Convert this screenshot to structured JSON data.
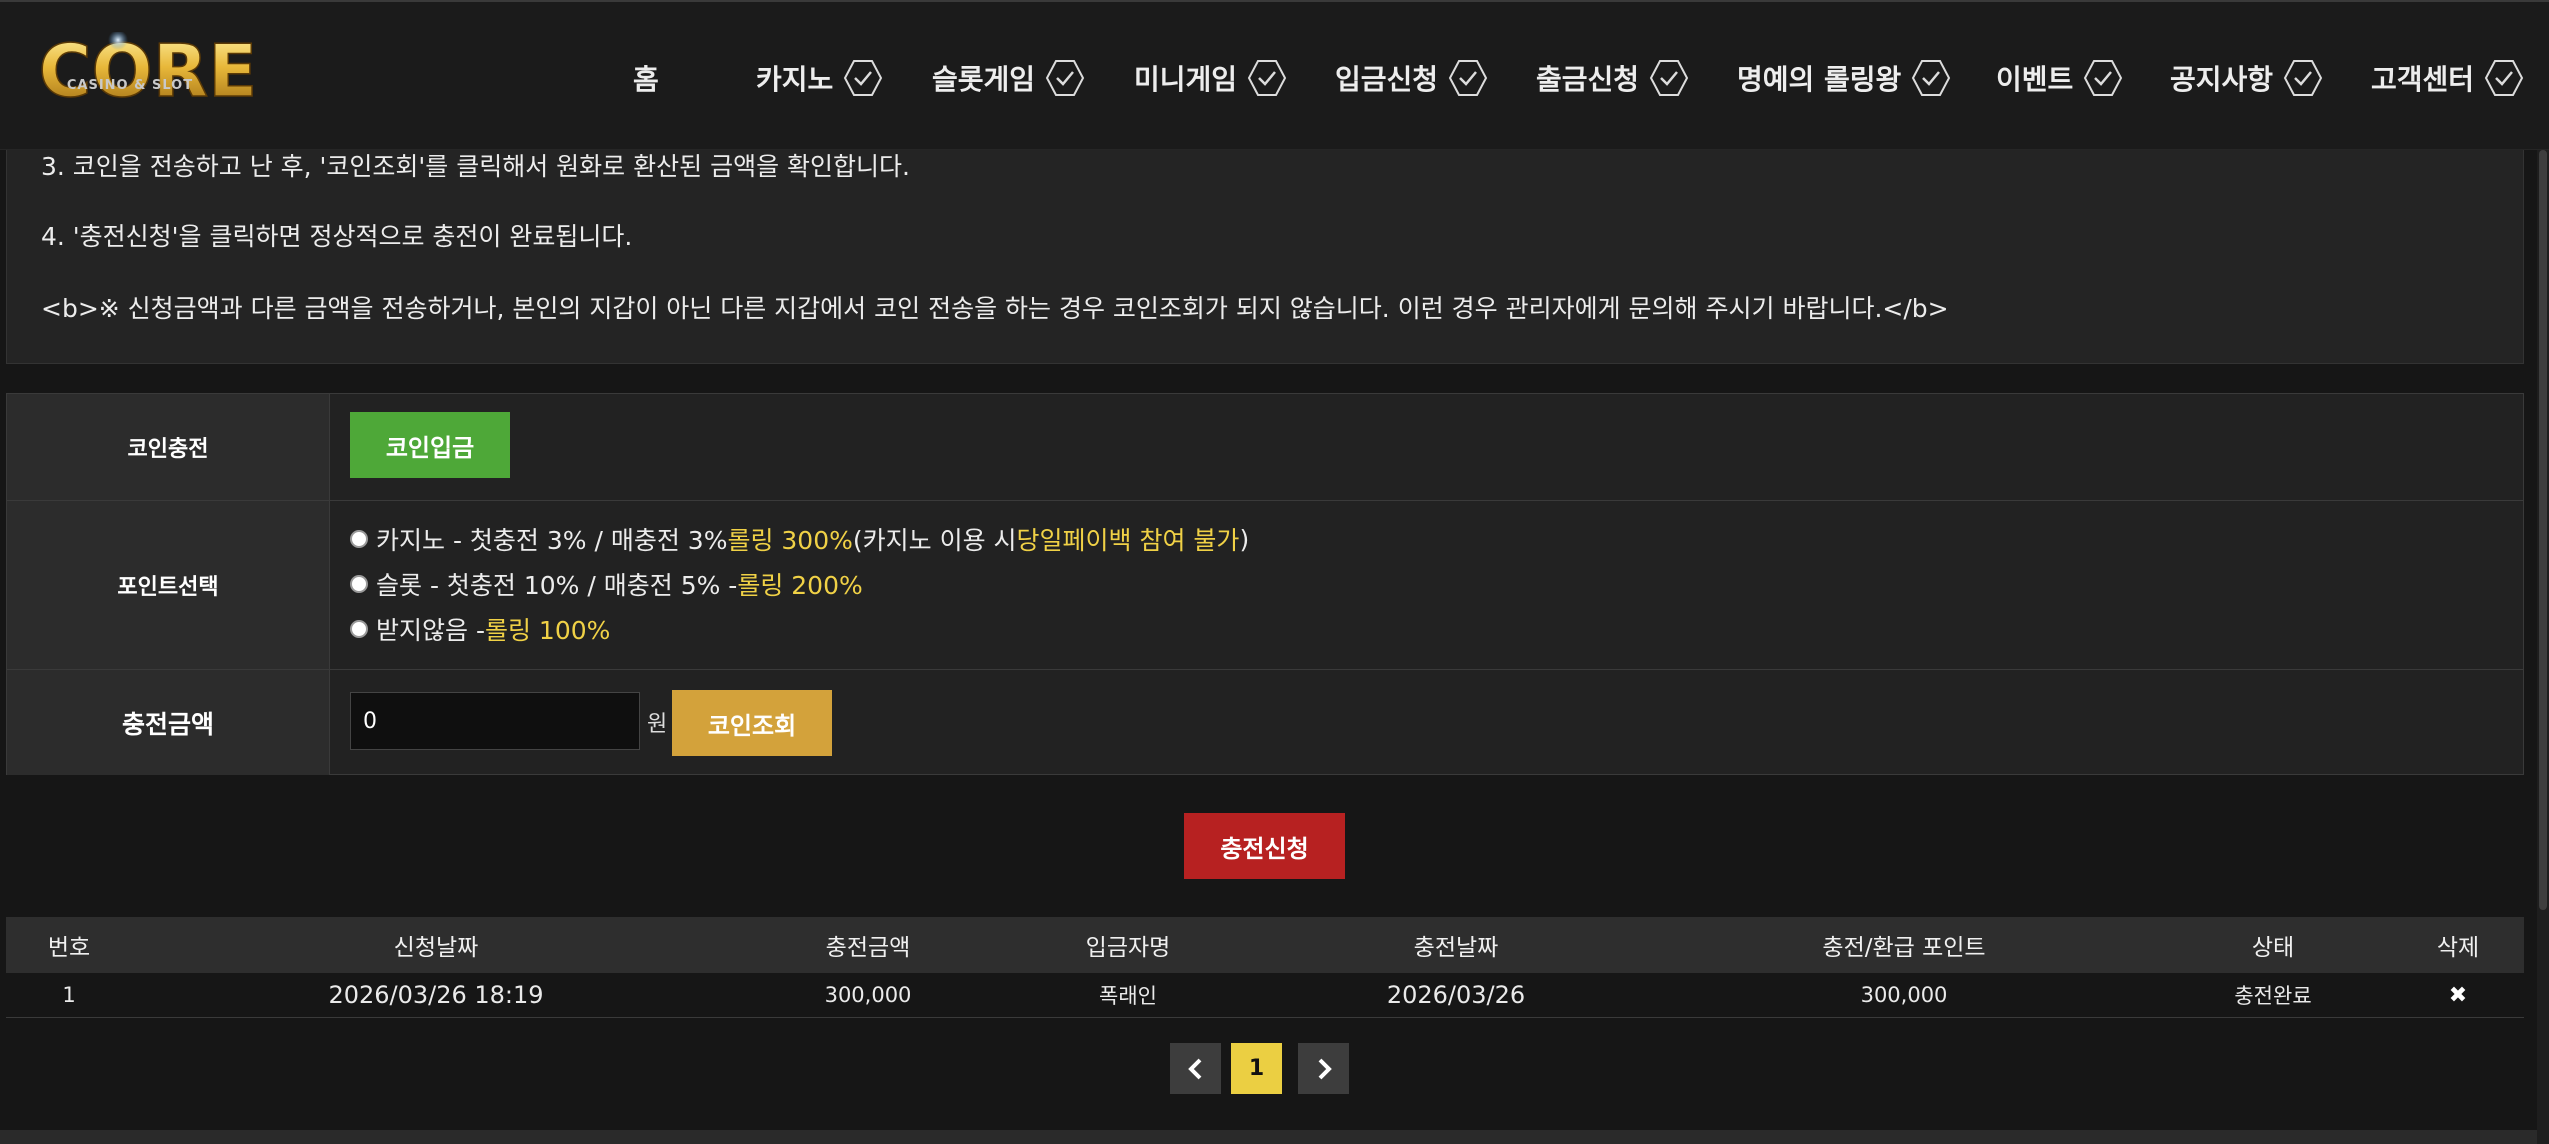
{
  "brand": {
    "logo_text": "CORE",
    "logo_subtitle": "CASINO & SLOT"
  },
  "nav": {
    "items": [
      {
        "label": "홈",
        "has_check": false
      },
      {
        "label": "카지노",
        "has_check": true
      },
      {
        "label": "슬롯게임",
        "has_check": true
      },
      {
        "label": "미니게임",
        "has_check": true
      },
      {
        "label": "입금신청",
        "has_check": true
      },
      {
        "label": "출금신청",
        "has_check": true
      },
      {
        "label": "명예의 롤링왕",
        "has_check": true
      },
      {
        "label": "이벤트",
        "has_check": true
      },
      {
        "label": "공지사항",
        "has_check": true
      },
      {
        "label": "고객센터",
        "has_check": true
      }
    ]
  },
  "info": {
    "lines": [
      "3. 코인을 전송하고 난 후, '코인조회'를 클릭해서 원화로 환산된 금액을 확인합니다.",
      "4. '충전신청'을 클릭하면 정상적으로 충전이 완료됩니다.",
      "<b>※ 신청금액과 다른 금액을 전송하거나, 본인의 지갑이 아닌 다른 지갑에서 코인 전송을 하는 경우 코인조회가 되지 않습니다. 이런 경우 관리자에게 문의해 주시기 바랍니다.</b>"
    ]
  },
  "form": {
    "coin_charge": {
      "label": "코인충전",
      "button": "코인입금"
    },
    "point_select": {
      "label": "포인트선택",
      "options": [
        {
          "text": "카지노 - 첫충전 3% / 매충전 3% ",
          "highlight": "롤링 300%",
          "tail_open": " (카지노 이용 시 ",
          "tail_highlight": "당일페이백 참여 불가",
          "tail_close": ")"
        },
        {
          "text": "슬롯 - 첫충전 10% / 매충전 5% - ",
          "highlight": "롤링 200%"
        },
        {
          "text": "받지않음 - ",
          "highlight": "롤링 100%"
        }
      ]
    },
    "amount": {
      "label": "충전금액",
      "value": "0",
      "unit": "원",
      "button": "코인조회"
    },
    "submit": "충전신청"
  },
  "history": {
    "columns": [
      "번호",
      "신청날짜",
      "충전금액",
      "입금자명",
      "충전날짜",
      "충전/환급 포인트",
      "상태",
      "삭제"
    ],
    "rows": [
      {
        "no": "1",
        "request_date": "2026/03/26 18:19",
        "amount": "300,000",
        "depositor": "폭래인",
        "charge_date": "2026/03/26",
        "points": "300,000",
        "status": "충전완료",
        "delete": "✖"
      }
    ]
  },
  "pagination": {
    "prev": "‹",
    "current": "1",
    "next": "›"
  },
  "colors": {
    "accent_yellow": "#f0d146",
    "green_button": "#4ea838",
    "gold_button": "#d3a23b",
    "red_button": "#b72121",
    "page_current": "#ebcf42"
  }
}
